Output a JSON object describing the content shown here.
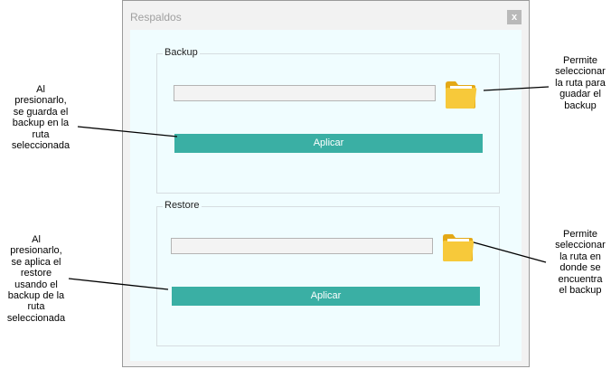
{
  "window": {
    "title": "Respaldos",
    "close_glyph": "x"
  },
  "backup": {
    "group_title": "Backup",
    "path_value": "",
    "folder_icon": "folder-icon",
    "apply_label": "Aplicar"
  },
  "restore": {
    "group_title": "Restore",
    "path_value": "",
    "folder_icon": "folder-icon",
    "apply_label": "Aplicar"
  },
  "annotations": {
    "backup_apply": "Al\npresionarlo,\nse guarda el\nbackup en la\nruta\nseleccionada",
    "backup_folder": "Permite\nseleccionar\nla ruta para\nguadar el\nbackup",
    "restore_apply": "Al\npresionarlo,\nse aplica el\nrestore\nusando el\nbackup de la\nruta\nseleccionada",
    "restore_folder": "Permite\nseleccionar\nla ruta en\ndonde se\nencuentra\nel backup"
  },
  "colors": {
    "accent": "#3aafa4",
    "folder": "#f5c431",
    "client_bg": "#f0fdff"
  }
}
